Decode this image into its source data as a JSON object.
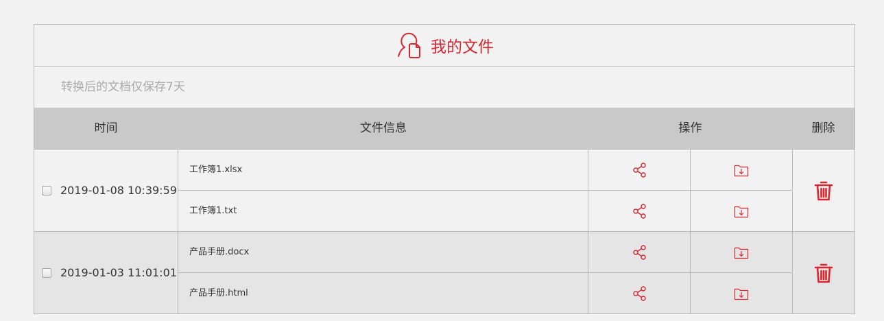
{
  "header": {
    "title": "我的文件",
    "title_icon": "user-file-icon",
    "accent_color": "#d9262f"
  },
  "notice": "转换后的文档仅保存7天",
  "table": {
    "columns": [
      "时间",
      "文件信息",
      "操作",
      "删除"
    ],
    "groups": [
      {
        "time": "2019-01-08 10:39:59",
        "checked": false,
        "files": [
          {
            "name": "工作簿1.xlsx"
          },
          {
            "name": "工作簿1.txt"
          }
        ]
      },
      {
        "time": "2019-01-03 11:01:01",
        "checked": false,
        "files": [
          {
            "name": "产品手册.docx"
          },
          {
            "name": "产品手册.html"
          }
        ]
      }
    ]
  },
  "icons": {
    "share": "share-icon",
    "download": "folder-download-icon",
    "delete": "trash-icon"
  }
}
